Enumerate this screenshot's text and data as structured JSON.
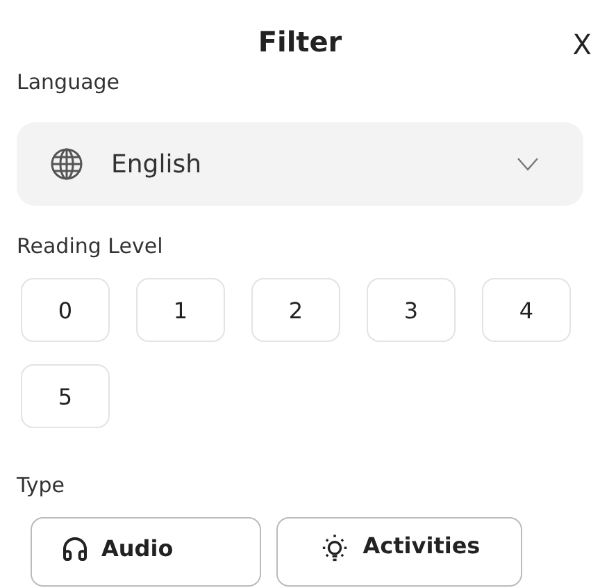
{
  "header": {
    "title": "Filter",
    "close": "X"
  },
  "language": {
    "label": "Language",
    "value": "English"
  },
  "reading_level": {
    "label": "Reading Level",
    "options": [
      "0",
      "1",
      "2",
      "3",
      "4",
      "5"
    ]
  },
  "type": {
    "label": "Type",
    "options": [
      {
        "label": "Audio",
        "kind": "audio"
      },
      {
        "label": "Activities",
        "kind": "activities"
      }
    ]
  }
}
